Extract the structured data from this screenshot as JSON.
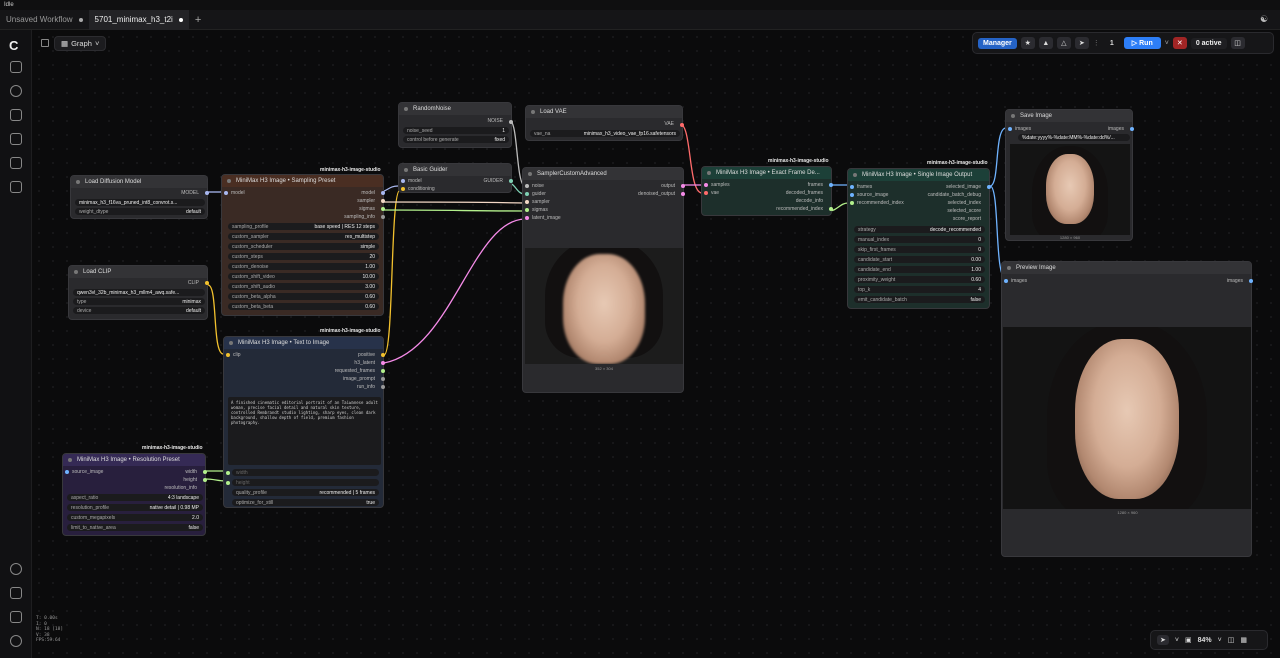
{
  "window": {
    "title": "Idle"
  },
  "tabs": [
    {
      "label": "Unsaved Workflow"
    },
    {
      "label": "5701_minimax_h3_t2i"
    }
  ],
  "toolbar": {
    "graph_label": "Graph",
    "manager_label": "Manager",
    "queue_count": "1",
    "run_label": "Run",
    "active_label": "0 active",
    "zoom": "84%"
  },
  "status": {
    "lines": [
      "T: 0.00s",
      "I: 0",
      "N: 18 [18]",
      "V: 38",
      "FPS:59.64"
    ]
  },
  "nodes": {
    "random_noise": {
      "title": "RandomNoise",
      "out_noise": "NOISE",
      "w1_label": "noise_seed",
      "w1_value": "1",
      "w2_label": "control before generate",
      "w2_value": "fixed"
    },
    "load_vae": {
      "title": "Load VAE",
      "out_vae": "VAE",
      "w1_label": "vae_na",
      "w1_value": "minimax_h3_video_vae_fp16.safetensors"
    },
    "basic_guider": {
      "title": "Basic Guider",
      "in_model": "model",
      "in_cond": "conditioning",
      "out": "GUIDER"
    },
    "sampler_custom": {
      "title": "SamplerCustomAdvanced",
      "in1": "noise",
      "in2": "guider",
      "in3": "sampler",
      "in4": "sigmas",
      "in5": "latent_image",
      "out1": "output",
      "out2": "denoised_output",
      "caption": "352 × 304"
    },
    "load_diffusion": {
      "title": "Load Diffusion Model",
      "out": "MODEL",
      "w1_value": "minimax_h3_f16va_pruned_int8_convrot.s...",
      "w2_label": "weight_dtype",
      "w2_value": "default"
    },
    "load_clip": {
      "title": "Load CLIP",
      "out": "CLIP",
      "w1_value": "qwen3vl_32b_minimax_h3_mllm4_awq.safe...",
      "w2_label": "type",
      "w2_value": "minimax",
      "w3_label": "device",
      "w3_value": "default"
    },
    "sampling_preset": {
      "badge": "minimax-h3-image-studio",
      "title": "MiniMax H3 Image • Sampling Preset",
      "in_model": "model",
      "out_model": "model",
      "out_sampler": "sampler",
      "out_sigmas": "sigmas",
      "out_info": "sampling_info",
      "widgets": [
        {
          "label": "sampling_profile",
          "value": "base speed | RES 12 steps"
        },
        {
          "label": "custom_sampler",
          "value": "res_multistep"
        },
        {
          "label": "custom_scheduler",
          "value": "simple"
        },
        {
          "label": "custom_steps",
          "value": "20"
        },
        {
          "label": "custom_denoise",
          "value": "1.00"
        },
        {
          "label": "custom_shift_video",
          "value": "10.00"
        },
        {
          "label": "custom_shift_audio",
          "value": "3.00"
        },
        {
          "label": "custom_beta_alpha",
          "value": "0.60"
        },
        {
          "label": "custom_beta_beta",
          "value": "0.60"
        }
      ]
    },
    "text_to_image": {
      "badge": "minimax-h3-image-studio",
      "title": "MiniMax H3 Image • Text to Image",
      "in_clip": "clip",
      "out1": "positive",
      "out2": "h3_latent",
      "out3": "requested_frames",
      "out4": "image_prompt",
      "out5": "run_info",
      "prompt": "A finished cinematic editorial portrait of an Taiwanese adult woman, precise facial detail and natural skin texture, controlled Rembrandt studio lighting, sharp eyes, clean dark background, shallow depth of field, premium fashion photography.",
      "in_width": "width",
      "in_height": "height",
      "w1_label": "quality_profile",
      "w1_value": "recommended | 5 frames",
      "w2_label": "optimize_for_still",
      "w2_value": "true"
    },
    "resolution_preset": {
      "badge": "minimax-h3-image-studio",
      "title": "MiniMax H3 Image • Resolution Preset",
      "in_src": "source_image",
      "out1": "width",
      "out2": "height",
      "out3": "resolution_info",
      "widgets": [
        {
          "label": "aspect_ratio",
          "value": "4:3 landscape"
        },
        {
          "label": "resolution_profile",
          "value": "native detail | 0.98 MP"
        },
        {
          "label": "custom_megapixels",
          "value": "2.0"
        },
        {
          "label": "limit_to_native_area",
          "value": "false"
        }
      ]
    },
    "extract_frame": {
      "badge": "minimax-h3-image-studio",
      "title": "MiniMax H3 Image • Exact Frame De...",
      "in1": "samples",
      "in2": "vae",
      "out1": "frames",
      "out2": "decoded_frames",
      "out3": "decode_info",
      "out4": "recommended_index"
    },
    "single_output": {
      "badge": "minimax-h3-image-studio",
      "title": "MiniMax H3 Image • Single Image Output",
      "in1": "frames",
      "in2": "source_image",
      "in3": "recommended_index",
      "out1": "selected_image",
      "out2": "candidate_batch_debug",
      "out3": "selected_index",
      "out4": "selected_score",
      "out5": "score_report",
      "widgets": [
        {
          "label": "strategy",
          "value": "decode_recommended"
        },
        {
          "label": "manual_index",
          "value": "0"
        },
        {
          "label": "skip_first_frames",
          "value": "0"
        },
        {
          "label": "candidate_start",
          "value": "0.00"
        },
        {
          "label": "candidate_end",
          "value": "1.00"
        },
        {
          "label": "proximity_weight",
          "value": "0.60"
        },
        {
          "label": "top_k",
          "value": "4"
        },
        {
          "label": "emit_candidate_batch",
          "value": "false"
        }
      ]
    },
    "save_image": {
      "title": "Save Image",
      "in": "images",
      "out": "images",
      "w1_value": "%date:yyyy%-%date:MM%-%date:dd%/...",
      "caption": "1280 × 960"
    },
    "preview_image": {
      "title": "Preview Image",
      "in": "images",
      "out": "images",
      "caption": "1280 × 960"
    }
  }
}
